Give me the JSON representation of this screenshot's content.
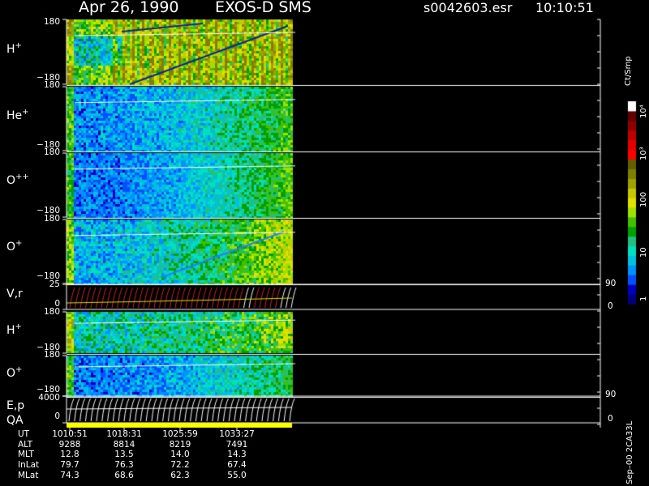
{
  "header": {
    "date": "Apr 26, 1990",
    "instrument": "EXOS-D SMS",
    "file": "s0042603.esr",
    "time": "10:10:51"
  },
  "chart_data": {
    "type": "heatmap",
    "panels": [
      {
        "label": "H",
        "sup": "+",
        "top_tick": "180",
        "bottom_tick": "−180"
      },
      {
        "label": "He",
        "sup": "+",
        "top_tick": "180",
        "bottom_tick": "−180"
      },
      {
        "label": "O",
        "sup": "++",
        "top_tick": "180",
        "bottom_tick": "−180"
      },
      {
        "label": "O",
        "sup": "+",
        "top_tick": "180",
        "bottom_tick": "−180"
      },
      {
        "label": "V,r",
        "sup": "",
        "top_tick": "25",
        "bottom_tick": "0",
        "right_top": "90",
        "right_bottom": "0"
      },
      {
        "label": "H",
        "sup": "+",
        "top_tick": "180",
        "bottom_tick": "−180"
      },
      {
        "label": "O",
        "sup": "+",
        "top_tick": "180",
        "bottom_tick": "−180"
      },
      {
        "label": "E,p",
        "sup": "",
        "top_tick": "4000",
        "bottom_tick": "0",
        "right_top": "90",
        "right_bottom": "0"
      }
    ],
    "qa_label": "QA",
    "colorbar": {
      "unit": "Ct/Smp",
      "ticks": [
        "1",
        "10",
        "100",
        "10³",
        "10⁴"
      ],
      "colors": [
        "#000080",
        "#0000c0",
        "#0050ff",
        "#0090ff",
        "#00c0e0",
        "#00e0c0",
        "#20c080",
        "#00a000",
        "#40c000",
        "#a0e000",
        "#e0e000",
        "#c8c800",
        "#a0a000",
        "#808000",
        "#606000",
        "#ff0000",
        "#e00000",
        "#c00000",
        "#900000",
        "#600000",
        "#ffffff"
      ]
    },
    "time_axis": {
      "rows": [
        {
          "label": "UT",
          "values": [
            "1010:51",
            "1018:31",
            "1025:59",
            "1033:27"
          ]
        },
        {
          "label": "ALT",
          "values": [
            "9288",
            "8814",
            "8219",
            "7491"
          ]
        },
        {
          "label": "MLT",
          "values": [
            "12.8",
            "13.5",
            "14.0",
            "14.3"
          ]
        },
        {
          "label": "InLat",
          "values": [
            "79.7",
            "76.3",
            "72.2",
            "67.4"
          ]
        },
        {
          "label": "MLat",
          "values": [
            "74.3",
            "68.6",
            "62.3",
            "55.0"
          ]
        }
      ]
    },
    "side_label": "Sep–00 2CA33L"
  }
}
